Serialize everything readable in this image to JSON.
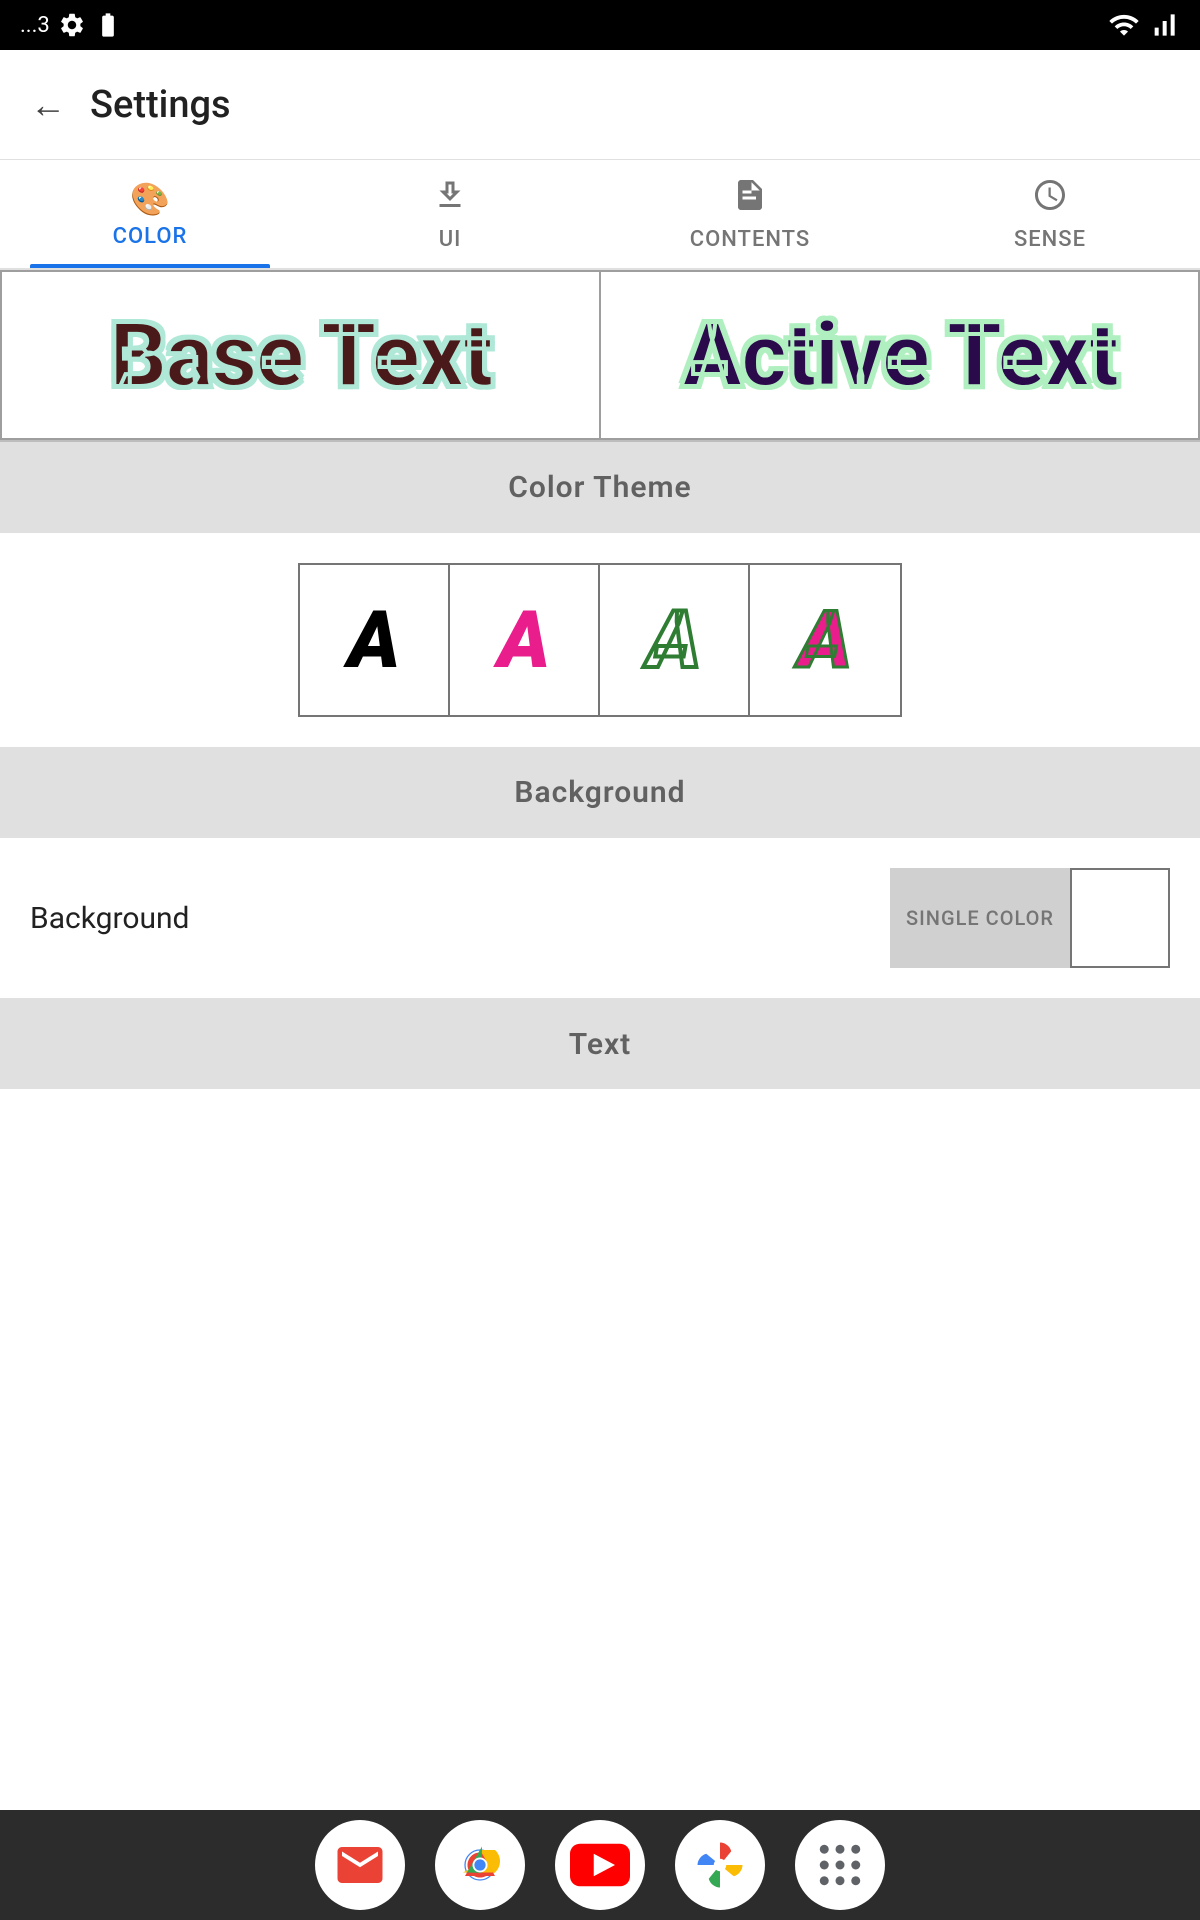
{
  "status_bar": {
    "time": "...3",
    "wifi_icon": "wifi-icon",
    "signal_icon": "signal-icon",
    "battery_icon": "battery-icon",
    "settings_icon": "settings-icon"
  },
  "app_bar": {
    "back_label": "←",
    "title": "Settings"
  },
  "tabs": [
    {
      "id": "color",
      "label": "COLOR",
      "icon": "palette-icon",
      "active": true
    },
    {
      "id": "ui",
      "label": "UI",
      "icon": "download-box-icon",
      "active": false
    },
    {
      "id": "contents",
      "label": "CONTENTS",
      "icon": "document-icon",
      "active": false
    },
    {
      "id": "sense",
      "label": "SENSE",
      "icon": "clock-icon",
      "active": false
    }
  ],
  "preview": {
    "base_text": "Base Text",
    "active_text": "Active Text"
  },
  "color_theme_section": {
    "label": "Color Theme"
  },
  "theme_options": [
    {
      "id": "black",
      "letter": "A",
      "style": "black"
    },
    {
      "id": "pink",
      "letter": "A",
      "style": "pink"
    },
    {
      "id": "green-outline",
      "letter": "A",
      "style": "green-outline"
    },
    {
      "id": "pink-green",
      "letter": "A",
      "style": "pink-green"
    }
  ],
  "background_section": {
    "label": "Background"
  },
  "background_row": {
    "label": "Background",
    "single_color_label": "SINGLE COLOR"
  },
  "text_section": {
    "label": "Text"
  },
  "bottom_nav": {
    "icons": [
      {
        "id": "gmail",
        "name": "gmail-icon"
      },
      {
        "id": "chrome",
        "name": "chrome-icon"
      },
      {
        "id": "youtube",
        "name": "youtube-icon"
      },
      {
        "id": "photos",
        "name": "photos-icon"
      },
      {
        "id": "apps",
        "name": "apps-icon"
      }
    ]
  }
}
